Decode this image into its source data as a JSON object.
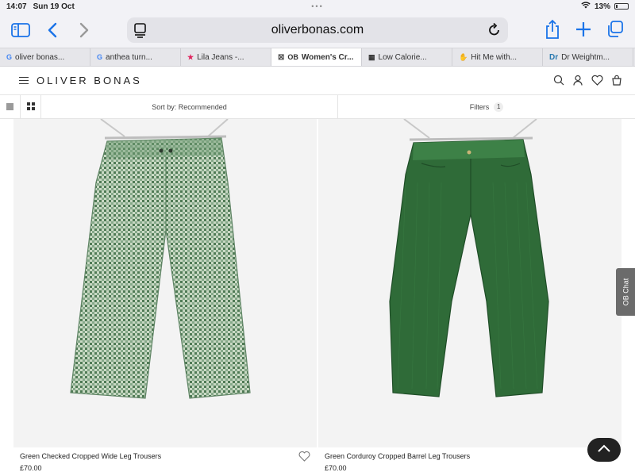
{
  "status": {
    "time": "14:07",
    "date": "Sun 19 Oct",
    "battery": "13%"
  },
  "browser": {
    "url": "oliverbonas.com",
    "tabs": [
      {
        "favicon": "G",
        "title": "oliver bonas..."
      },
      {
        "favicon": "G",
        "title": "anthea turn..."
      },
      {
        "favicon": "★",
        "title": "Lila Jeans -..."
      },
      {
        "favicon": "OB",
        "title": "Women's Cr..."
      },
      {
        "favicon": "▦",
        "title": "Low Calorie..."
      },
      {
        "favicon": "✋",
        "title": "Hit Me with..."
      },
      {
        "favicon": "Dr",
        "title": "Dr Weightm..."
      }
    ]
  },
  "site": {
    "logo": "OLIVER BONAS"
  },
  "filterbar": {
    "sort_label": "Sort by: Recommended",
    "filters_label": "Filters",
    "filters_count": "1"
  },
  "products": [
    {
      "name": "Green Checked Cropped Wide Leg Trousers",
      "price": "£70.00"
    },
    {
      "name": "Green Corduroy Cropped Barrel Leg Trousers",
      "price": "£70.00"
    }
  ],
  "chat": {
    "label": "OB Chat"
  },
  "colors": {
    "accent": "#1a73e8",
    "check_green": "#6f9b73",
    "cord_green": "#2f6b38"
  }
}
